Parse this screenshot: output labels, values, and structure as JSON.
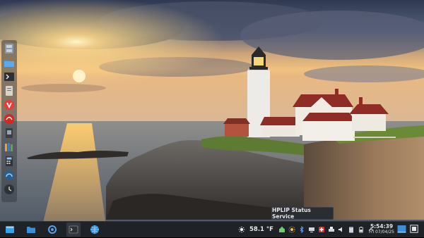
{
  "desktop": {
    "wallpaper": "lighthouse-sunset",
    "colors": {
      "sky_top": "#3d4a63",
      "sun": "#ffe29a",
      "sea": "#6f7a86",
      "taskbar": "#1f2227"
    }
  },
  "dock": {
    "items": [
      {
        "name": "file-cabinet-icon"
      },
      {
        "name": "folder-icon"
      },
      {
        "name": "terminal-icon"
      },
      {
        "name": "notes-icon"
      },
      {
        "name": "vivaldi-icon"
      },
      {
        "name": "vivaldi-red-icon"
      },
      {
        "name": "document-viewer-icon"
      },
      {
        "name": "library-icon"
      },
      {
        "name": "calculator-icon"
      },
      {
        "name": "system-monitor-icon"
      },
      {
        "name": "clock-app-icon"
      }
    ]
  },
  "tooltip": {
    "text": "HPLIP Status Service"
  },
  "taskbar": {
    "launchers": [
      {
        "name": "app-menu-icon"
      },
      {
        "name": "file-manager-icon"
      },
      {
        "name": "settings-icon"
      },
      {
        "name": "terminal-launcher-icon"
      },
      {
        "name": "browser-icon"
      }
    ],
    "weather": {
      "temperature": "58.1 °F",
      "icon": "sun-icon"
    },
    "clock": {
      "time": "5:54:39",
      "date": "Fri 07/04/25"
    }
  }
}
